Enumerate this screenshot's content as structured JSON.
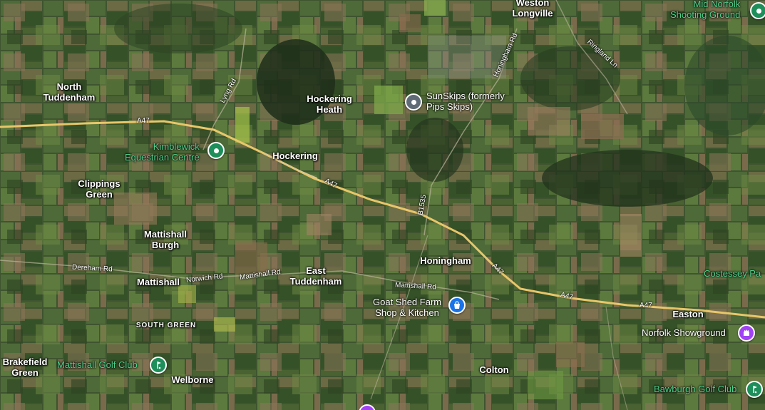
{
  "places": {
    "weston_longville": "Weston\nLongville",
    "north_tuddenham": "North\nTuddenham",
    "hockering_heath": "Hockering\nHeath",
    "hockering": "Hockering",
    "clippings_green": "Clippings\nGreen",
    "mattishall_burgh": "Mattishall\nBurgh",
    "mattishall": "Mattishall",
    "east_tuddenham": "East\nTuddenham",
    "honingham": "Honingham",
    "south_green": "SOUTH GREEN",
    "brakefield_green": "Brakefield\nGreen",
    "welborne": "Welborne",
    "colton": "Colton",
    "easton": "Easton"
  },
  "pois": {
    "mid_norfolk": "Mid Norfolk\nShooting Ground",
    "kimblewick": "Kimblewick\nEquestrian Centre",
    "sunskips": "SunSkips (formerly\nPips Skips)",
    "goat_shed": "Goat Shed Farm\nShop & Kitchen",
    "norfolk_showground": "Norfolk Showground",
    "mattishall_golf": "Mattishall Golf Club",
    "bawburgh_golf": "Bawburgh Golf Club",
    "costessey": "Costessey Pa"
  },
  "roads": {
    "a47_1": "A47",
    "a47_2": "A47",
    "a47_3": "A47",
    "a47_4": "A47",
    "a47_5": "A47",
    "lyng_rd": "Lyng Rd",
    "honingham_rd": "Honingham Rd",
    "ringland_ln": "Ringland Ln",
    "b1535": "B1535",
    "dereham_rd": "Dereham Rd",
    "norwich_rd": "Norwich Rd",
    "mattishall_rd_1": "Mattishall Rd",
    "mattishall_rd_2": "Mattishall Rd"
  },
  "colors": {
    "poi_green": "#1e8e5a",
    "poi_blue": "#1a73e8",
    "poi_purple": "#a142f4",
    "poi_gray": "#5f6b76",
    "road_yellow": "#e8c66a"
  },
  "icons": {
    "kimblewick": "map-pin-icon",
    "mid_norfolk": "map-pin-icon",
    "sunskips": "map-pin-icon",
    "goat_shed": "shopping-bag-icon",
    "norfolk_showground": "ticket-icon",
    "mattishall_golf": "golf-icon",
    "bawburgh_golf": "golf-icon"
  }
}
